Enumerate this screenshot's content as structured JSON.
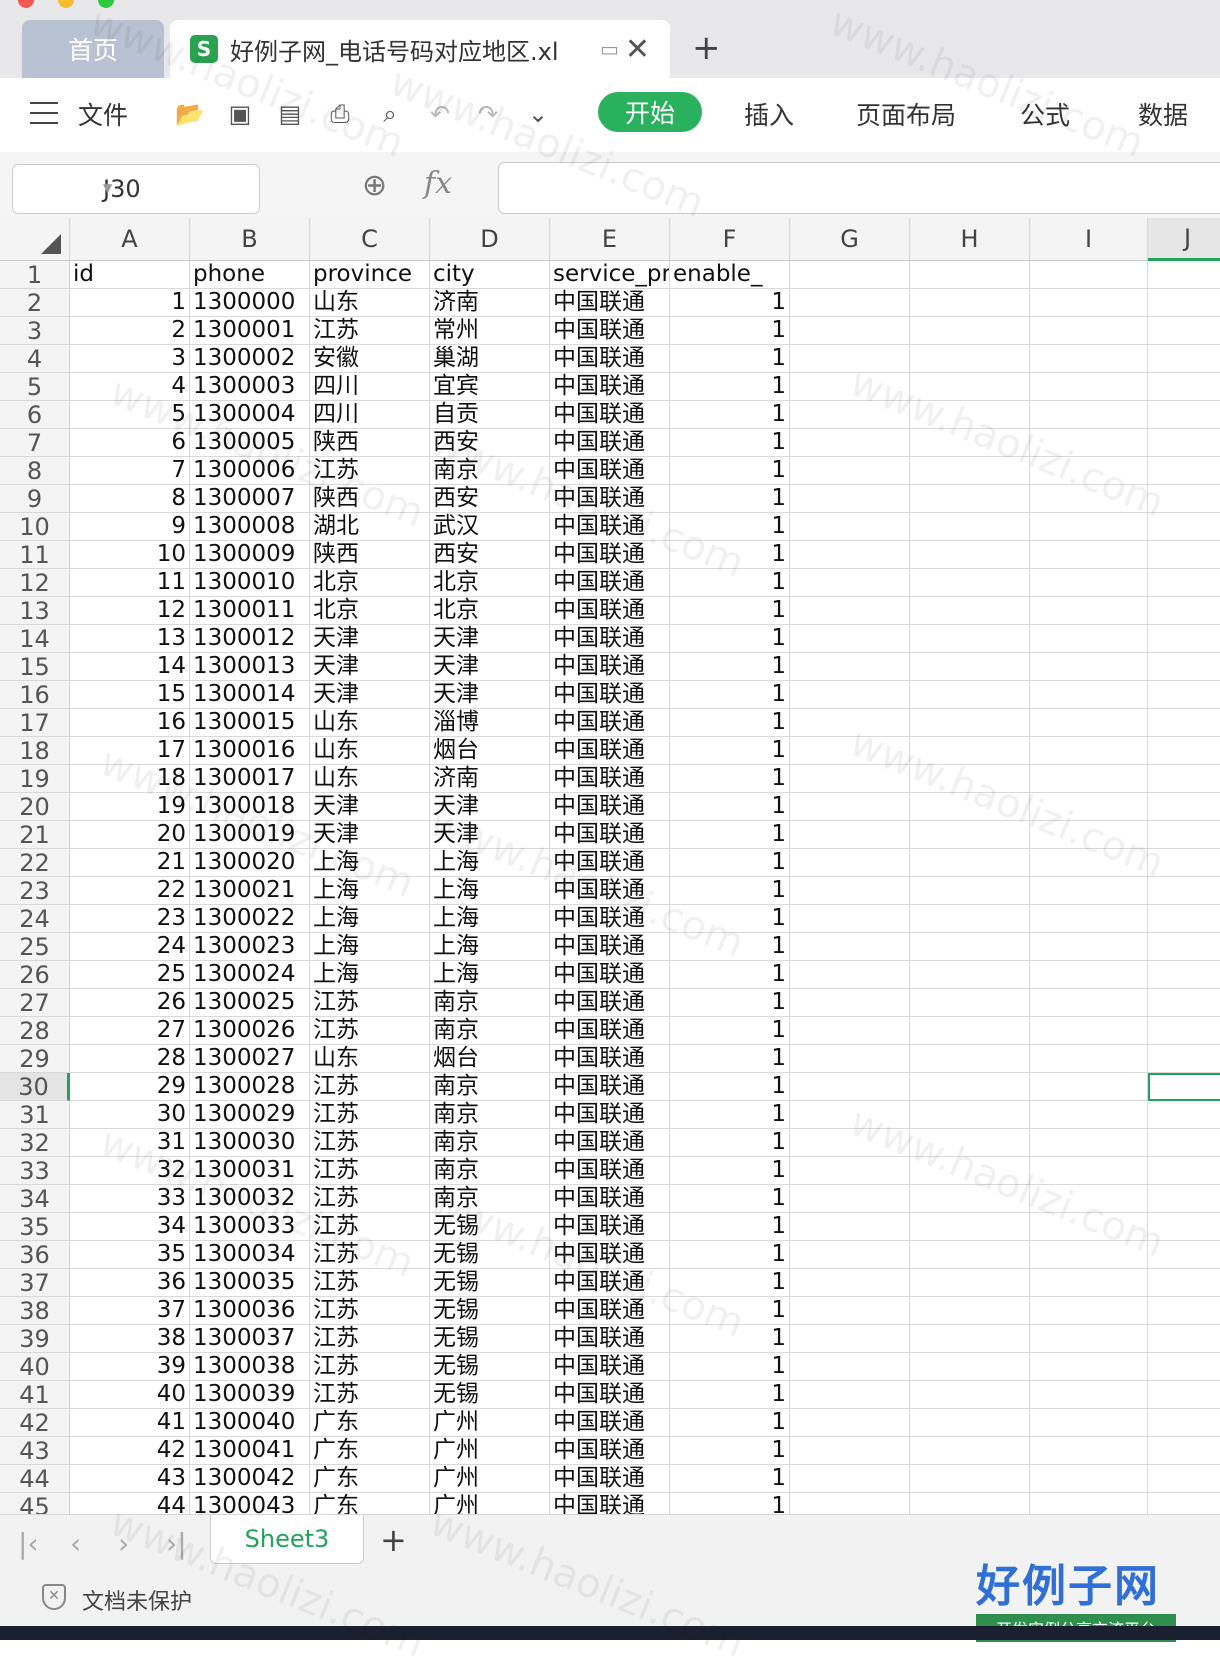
{
  "tabs": {
    "home": "首页",
    "doc": "好例子网_电话号码对应地区.xl",
    "doc_icon": "S"
  },
  "ribbon": {
    "file": "文件",
    "start": "开始",
    "items": [
      "插入",
      "页面布局",
      "公式",
      "数据"
    ]
  },
  "formula_bar": {
    "cell_ref": "J30",
    "fx": "fx",
    "value": ""
  },
  "columns": [
    "A",
    "B",
    "C",
    "D",
    "E",
    "F",
    "G",
    "H",
    "I",
    "J"
  ],
  "header_row": [
    "id",
    "phone",
    "province",
    "city",
    "service_pro",
    "enable_"
  ],
  "rows": [
    [
      1,
      "1300000",
      "山东",
      "济南",
      "中国联通",
      1
    ],
    [
      2,
      "1300001",
      "江苏",
      "常州",
      "中国联通",
      1
    ],
    [
      3,
      "1300002",
      "安徽",
      "巢湖",
      "中国联通",
      1
    ],
    [
      4,
      "1300003",
      "四川",
      "宜宾",
      "中国联通",
      1
    ],
    [
      5,
      "1300004",
      "四川",
      "自贡",
      "中国联通",
      1
    ],
    [
      6,
      "1300005",
      "陕西",
      "西安",
      "中国联通",
      1
    ],
    [
      7,
      "1300006",
      "江苏",
      "南京",
      "中国联通",
      1
    ],
    [
      8,
      "1300007",
      "陕西",
      "西安",
      "中国联通",
      1
    ],
    [
      9,
      "1300008",
      "湖北",
      "武汉",
      "中国联通",
      1
    ],
    [
      10,
      "1300009",
      "陕西",
      "西安",
      "中国联通",
      1
    ],
    [
      11,
      "1300010",
      "北京",
      "北京",
      "中国联通",
      1
    ],
    [
      12,
      "1300011",
      "北京",
      "北京",
      "中国联通",
      1
    ],
    [
      13,
      "1300012",
      "天津",
      "天津",
      "中国联通",
      1
    ],
    [
      14,
      "1300013",
      "天津",
      "天津",
      "中国联通",
      1
    ],
    [
      15,
      "1300014",
      "天津",
      "天津",
      "中国联通",
      1
    ],
    [
      16,
      "1300015",
      "山东",
      "淄博",
      "中国联通",
      1
    ],
    [
      17,
      "1300016",
      "山东",
      "烟台",
      "中国联通",
      1
    ],
    [
      18,
      "1300017",
      "山东",
      "济南",
      "中国联通",
      1
    ],
    [
      19,
      "1300018",
      "天津",
      "天津",
      "中国联通",
      1
    ],
    [
      20,
      "1300019",
      "天津",
      "天津",
      "中国联通",
      1
    ],
    [
      21,
      "1300020",
      "上海",
      "上海",
      "中国联通",
      1
    ],
    [
      22,
      "1300021",
      "上海",
      "上海",
      "中国联通",
      1
    ],
    [
      23,
      "1300022",
      "上海",
      "上海",
      "中国联通",
      1
    ],
    [
      24,
      "1300023",
      "上海",
      "上海",
      "中国联通",
      1
    ],
    [
      25,
      "1300024",
      "上海",
      "上海",
      "中国联通",
      1
    ],
    [
      26,
      "1300025",
      "江苏",
      "南京",
      "中国联通",
      1
    ],
    [
      27,
      "1300026",
      "江苏",
      "南京",
      "中国联通",
      1
    ],
    [
      28,
      "1300027",
      "山东",
      "烟台",
      "中国联通",
      1
    ],
    [
      29,
      "1300028",
      "江苏",
      "南京",
      "中国联通",
      1
    ],
    [
      30,
      "1300029",
      "江苏",
      "南京",
      "中国联通",
      1
    ],
    [
      31,
      "1300030",
      "江苏",
      "南京",
      "中国联通",
      1
    ],
    [
      32,
      "1300031",
      "江苏",
      "南京",
      "中国联通",
      1
    ],
    [
      33,
      "1300032",
      "江苏",
      "南京",
      "中国联通",
      1
    ],
    [
      34,
      "1300033",
      "江苏",
      "无锡",
      "中国联通",
      1
    ],
    [
      35,
      "1300034",
      "江苏",
      "无锡",
      "中国联通",
      1
    ],
    [
      36,
      "1300035",
      "江苏",
      "无锡",
      "中国联通",
      1
    ],
    [
      37,
      "1300036",
      "江苏",
      "无锡",
      "中国联通",
      1
    ],
    [
      38,
      "1300037",
      "江苏",
      "无锡",
      "中国联通",
      1
    ],
    [
      39,
      "1300038",
      "江苏",
      "无锡",
      "中国联通",
      1
    ],
    [
      40,
      "1300039",
      "江苏",
      "无锡",
      "中国联通",
      1
    ],
    [
      41,
      "1300040",
      "广东",
      "广州",
      "中国联通",
      1
    ],
    [
      42,
      "1300041",
      "广东",
      "广州",
      "中国联通",
      1
    ],
    [
      43,
      "1300042",
      "广东",
      "广州",
      "中国联通",
      1
    ],
    [
      44,
      "1300043",
      "广东",
      "广州",
      "中国联通",
      1
    ]
  ],
  "selected_row": 30,
  "selected_col": "J",
  "sheet_tab": "Sheet3",
  "status": "文档未保护",
  "logo": {
    "main": "好例子网",
    "sub": "开发实例分享交流平台"
  },
  "watermark": "www.haolizi.com",
  "colors": {
    "accent": "#21a35a",
    "start_button": "#2ab15e"
  }
}
